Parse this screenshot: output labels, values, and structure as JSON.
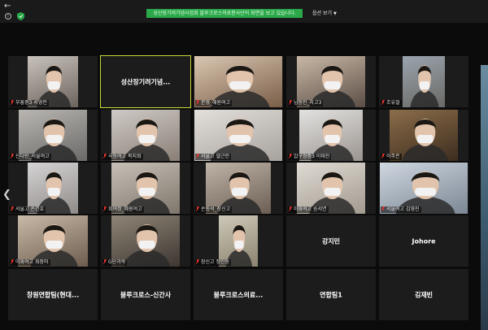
{
  "window": {
    "share_banner": "성산장기려기념사업회 블루크로스의료봉사단의 화면을 보고 있습니다.",
    "view_options_label": "옵션 보기"
  },
  "colors": {
    "banner": "#2aa84a",
    "active_speaker": "#c9d836",
    "mic_muted": "#e0352b"
  },
  "tiles": [
    {
      "id": "t1",
      "name": "부흥중3 서영린",
      "video": true,
      "muted": true
    },
    {
      "id": "t2",
      "name": "성산장기려기념...",
      "video": false,
      "active": true
    },
    {
      "id": "t3",
      "name": "문영_혜원여고",
      "video": true,
      "muted": true
    },
    {
      "id": "t4",
      "name": "남동인_자고3",
      "video": true,
      "muted": true
    },
    {
      "id": "t5",
      "name": "조유철",
      "video": true,
      "muted": true
    },
    {
      "id": "t6",
      "name": "신다빈_서울여고",
      "video": true,
      "muted": true
    },
    {
      "id": "t7",
      "name": "국동여고 북지희",
      "video": true,
      "muted": true
    },
    {
      "id": "t8",
      "name": "서울고 넬근린",
      "video": true,
      "muted": true
    },
    {
      "id": "t9",
      "name": "압구정중3 이태진",
      "video": true,
      "muted": true
    },
    {
      "id": "t10",
      "name": "이주은",
      "video": true,
      "muted": true
    },
    {
      "id": "t11",
      "name": "서울고 손건호",
      "video": true,
      "muted": true
    },
    {
      "id": "t12",
      "name": "회여정_혜원여고",
      "video": true,
      "muted": true
    },
    {
      "id": "t13",
      "name": "손동석_장신고",
      "video": true,
      "muted": true
    },
    {
      "id": "t14",
      "name": "이화여고 송서연",
      "video": true,
      "muted": true
    },
    {
      "id": "t15",
      "name": "서울여고 김영진",
      "video": true,
      "muted": true
    },
    {
      "id": "t16",
      "name": "이화여고 최장미",
      "video": true,
      "muted": true
    },
    {
      "id": "t17",
      "name": "G단과학",
      "video": true,
      "muted": true
    },
    {
      "id": "t18",
      "name": "장신고 정민동",
      "video": true,
      "muted": true
    },
    {
      "id": "t19",
      "name": "강지민",
      "video": false
    },
    {
      "id": "t20",
      "name": "Johore",
      "video": false
    },
    {
      "id": "t21",
      "name": "창원연합팀(현대...",
      "video": false
    },
    {
      "id": "t22",
      "name": "블루크로스-신간사",
      "video": false
    },
    {
      "id": "t23",
      "name": "블루크로스의료...",
      "video": false
    },
    {
      "id": "t24",
      "name": "연합팀1",
      "video": false
    },
    {
      "id": "t25",
      "name": "김재빈",
      "video": false
    }
  ]
}
